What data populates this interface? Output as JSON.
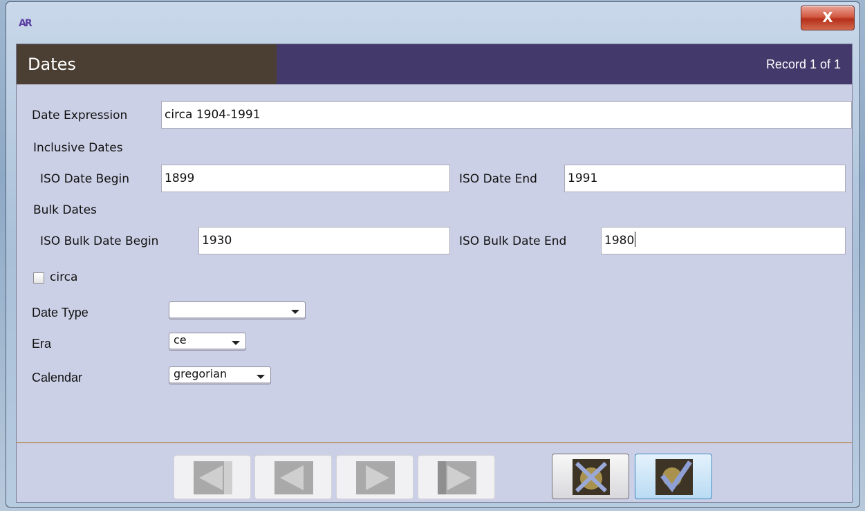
{
  "window": {
    "app_icon_text": "AR",
    "close_label": "X"
  },
  "header": {
    "title": "Dates",
    "record_label": "Record 1 of 1"
  },
  "form": {
    "date_expression": {
      "label": "Date Expression",
      "value": "circa 1904-1991"
    },
    "inclusive_dates_heading": "Inclusive Dates",
    "iso_date_begin": {
      "label": "ISO Date Begin",
      "value": "1899"
    },
    "iso_date_end": {
      "label": "ISO Date End",
      "value": "1991"
    },
    "bulk_dates_heading": "Bulk Dates",
    "iso_bulk_date_begin": {
      "label": "ISO Bulk Date Begin",
      "value": "1930"
    },
    "iso_bulk_date_end": {
      "label": "ISO Bulk Date End",
      "value": "1980"
    },
    "circa": {
      "label": "circa",
      "checked": false
    },
    "date_type": {
      "label": "Date Type",
      "value": ""
    },
    "era": {
      "label": "Era",
      "value": "ce"
    },
    "calendar": {
      "label": "Calendar",
      "value": "gregorian"
    }
  },
  "footer": {
    "buttons": [
      {
        "name": "first-record",
        "icon": "first-record-icon",
        "enabled": false
      },
      {
        "name": "previous-record",
        "icon": "previous-record-icon",
        "enabled": false
      },
      {
        "name": "next-record",
        "icon": "next-record-icon",
        "enabled": false
      },
      {
        "name": "last-record",
        "icon": "last-record-icon",
        "enabled": false
      },
      {
        "name": "cancel",
        "icon": "cancel-x-icon",
        "enabled": true
      },
      {
        "name": "ok",
        "icon": "ok-check-icon",
        "enabled": true
      }
    ]
  },
  "colors": {
    "header_left": "#4b3f33",
    "header_right": "#433a6b",
    "panel_bg": "#ccd0e6",
    "divider": "#b89b7a"
  }
}
